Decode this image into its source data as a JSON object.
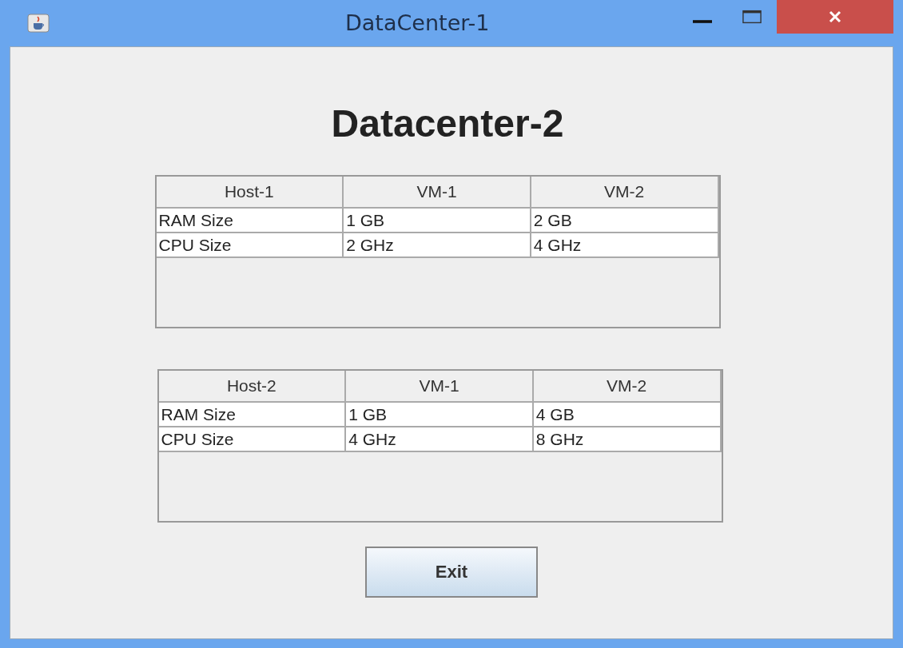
{
  "window": {
    "title": "DataCenter-1"
  },
  "heading": "Datacenter-2",
  "tables": [
    {
      "columns": [
        "Host-1",
        "VM-1",
        "VM-2"
      ],
      "rows": [
        [
          "RAM Size",
          "1 GB",
          "2 GB"
        ],
        [
          "CPU Size",
          "2 GHz",
          "4 GHz"
        ]
      ]
    },
    {
      "columns": [
        "Host-2",
        "VM-1",
        "VM-2"
      ],
      "rows": [
        [
          "RAM Size",
          "1 GB",
          "4 GB"
        ],
        [
          "CPU Size",
          "4 GHz",
          "8 GHz"
        ]
      ]
    }
  ],
  "buttons": [
    "Exit"
  ]
}
